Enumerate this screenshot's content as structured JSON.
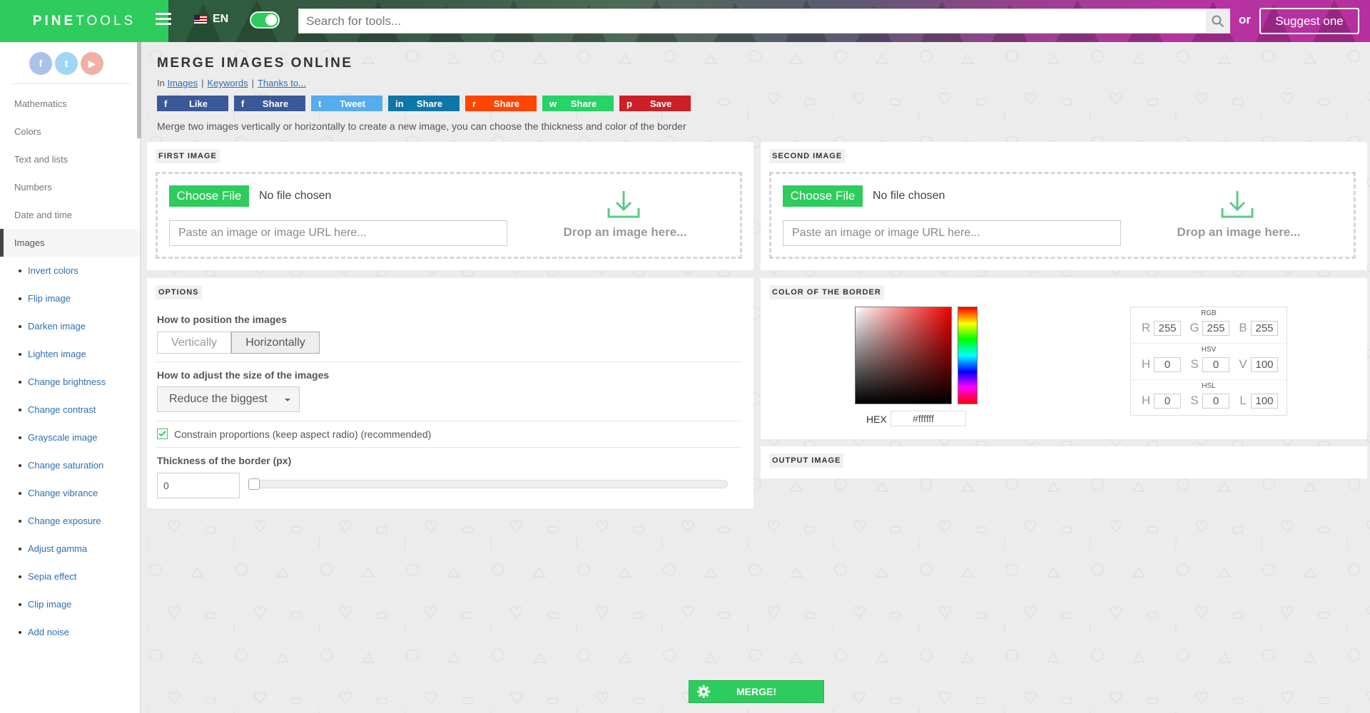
{
  "header": {
    "logo_bold": "PINE",
    "logo_light": "TOOLS",
    "lang": "EN",
    "search_placeholder": "Search for tools...",
    "or": "or",
    "suggest": "Suggest one"
  },
  "sidebar": {
    "categories": [
      "Mathematics",
      "Colors",
      "Text and lists",
      "Numbers",
      "Date and time",
      "Images"
    ],
    "active": "Images",
    "subitems": [
      "Invert colors",
      "Flip image",
      "Darken image",
      "Lighten image",
      "Change brightness",
      "Change contrast",
      "Grayscale image",
      "Change saturation",
      "Change vibrance",
      "Change exposure",
      "Adjust gamma",
      "Sepia effect",
      "Clip image",
      "Add noise"
    ]
  },
  "page": {
    "title": "MERGE IMAGES ONLINE",
    "in": "In",
    "crumbs": [
      "Images",
      "Keywords",
      "Thanks to..."
    ],
    "description": "Merge two images vertically or horizontally to create a new image, you can choose the thickness and color of the border"
  },
  "shares": [
    {
      "label": "Like",
      "icon": "f",
      "color": "#3b5998"
    },
    {
      "label": "Share",
      "icon": "f",
      "color": "#3b5998"
    },
    {
      "label": "Tweet",
      "icon": "t",
      "color": "#55acee"
    },
    {
      "label": "Share",
      "icon": "in",
      "color": "#0e76a8"
    },
    {
      "label": "Share",
      "icon": "r",
      "color": "#ff4500"
    },
    {
      "label": "Share",
      "icon": "w",
      "color": "#25d366"
    },
    {
      "label": "Save",
      "icon": "p",
      "color": "#cb2027"
    }
  ],
  "first_image": {
    "title": "FIRST IMAGE",
    "choose": "Choose File",
    "nofile": "No file chosen",
    "url_placeholder": "Paste an image or image URL here...",
    "drop": "Drop an image here..."
  },
  "second_image": {
    "title": "SECOND IMAGE",
    "choose": "Choose File",
    "nofile": "No file chosen",
    "url_placeholder": "Paste an image or image URL here...",
    "drop": "Drop an image here..."
  },
  "options": {
    "title": "OPTIONS",
    "position_label": "How to position the images",
    "vertically": "Vertically",
    "horizontally": "Horizontally",
    "size_label": "How to adjust the size of the images",
    "size_value": "Reduce the biggest",
    "constrain": "Constrain proportions (keep aspect radio) (recommended)",
    "thickness_label": "Thickness of the border (px)",
    "thickness_value": "0"
  },
  "border_color": {
    "title": "COLOR OF THE BORDER",
    "hex_label": "HEX",
    "hex_value": "#ffffff",
    "rgb_title": "RGB",
    "hsv_title": "HSV",
    "hsl_title": "HSL",
    "rgb": [
      {
        "l": "R",
        "v": "255"
      },
      {
        "l": "G",
        "v": "255"
      },
      {
        "l": "B",
        "v": "255"
      }
    ],
    "hsv": [
      {
        "l": "H",
        "v": "0"
      },
      {
        "l": "S",
        "v": "0"
      },
      {
        "l": "V",
        "v": "100"
      }
    ],
    "hsl": [
      {
        "l": "H",
        "v": "0"
      },
      {
        "l": "S",
        "v": "0"
      },
      {
        "l": "L",
        "v": "100"
      }
    ]
  },
  "output": {
    "title": "OUTPUT IMAGE"
  },
  "merge": "MERGE!"
}
